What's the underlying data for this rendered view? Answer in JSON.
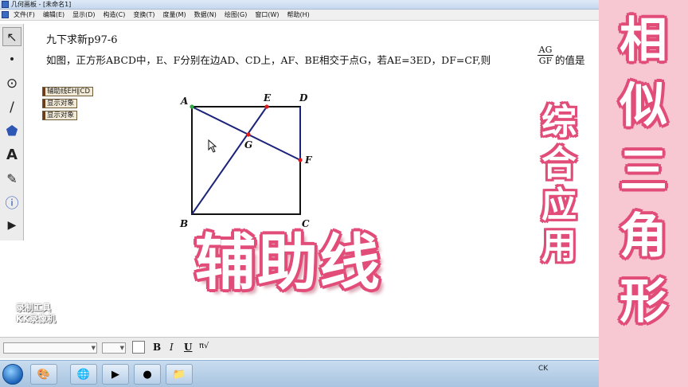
{
  "window": {
    "title": "几何画板 - [未命名1]"
  },
  "menu": [
    "文件(F)",
    "编辑(E)",
    "显示(D)",
    "构造(C)",
    "变换(T)",
    "度量(M)",
    "数据(N)",
    "绘图(G)",
    "窗口(W)",
    "帮助(H)"
  ],
  "tools": [
    {
      "icon": "arrow-select-icon",
      "glyph": "↖"
    },
    {
      "icon": "point-tool-icon",
      "glyph": "•"
    },
    {
      "icon": "compass-tool-icon",
      "glyph": "⊙"
    },
    {
      "icon": "straightedge-tool-icon",
      "glyph": "/"
    },
    {
      "icon": "polygon-tool-icon",
      "glyph": "⬟"
    },
    {
      "icon": "text-tool-icon",
      "glyph": "A"
    },
    {
      "icon": "marker-tool-icon",
      "glyph": "✎"
    },
    {
      "icon": "information-tool-icon",
      "glyph": "ⓘ"
    },
    {
      "icon": "custom-tool-icon",
      "glyph": "▶"
    }
  ],
  "problem": {
    "title": "九下求新p97-6",
    "text": "如图，正方形ABCD中，E、F分别在边AD、CD上，AF、BE相交于点G，若AE=3ED，DF=CF,则",
    "fraction_numerator": "AG",
    "fraction_denominator": "GF",
    "suffix": "的值是",
    "tail": "("
  },
  "action_buttons": [
    "辅助线EH∥CD",
    "显示对象",
    "显示对象"
  ],
  "geometry_labels": {
    "A": "A",
    "B": "B",
    "C": "C",
    "D": "D",
    "E": "E",
    "F": "F",
    "G": "G"
  },
  "overlay": {
    "big_title": "辅助线",
    "side_title": "相似三角形",
    "side_subtitle": "综合应用",
    "watermark_line1": "录制工具",
    "watermark_line2": "KK录像机"
  },
  "format_toolbar": {
    "bold": "B",
    "italic": "I",
    "underline": "U",
    "symbol": "π√"
  },
  "tray": {
    "text": "CK"
  },
  "colors": {
    "accent_pink": "#e14d78",
    "banner_pink": "#f7c7d2",
    "segment_blue": "#1b237a",
    "point_red": "#e01b1b",
    "point_green": "#2fa845"
  }
}
